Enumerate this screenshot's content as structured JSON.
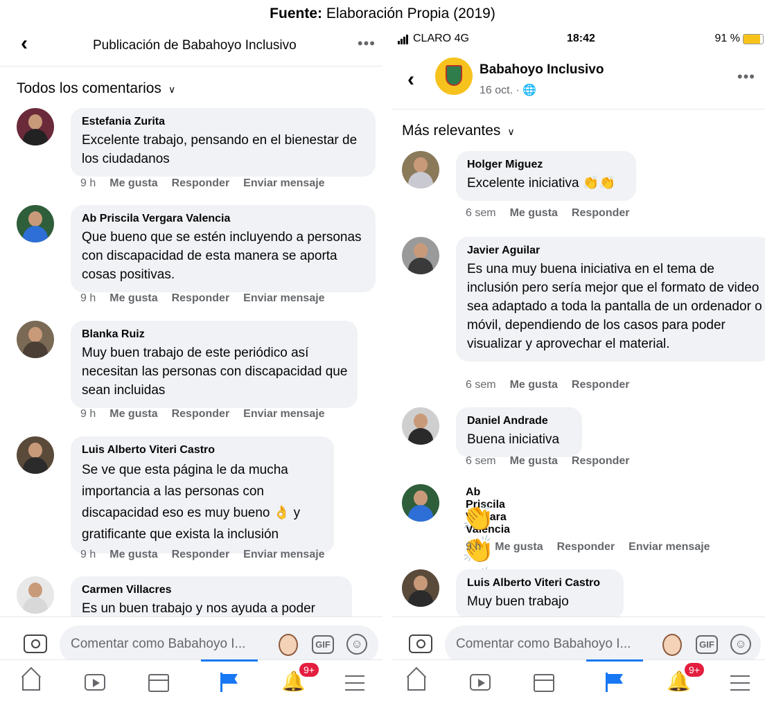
{
  "caption": {
    "bold": "Fuente:",
    "rest": " Elaboración Propia (2019)"
  },
  "left": {
    "header": {
      "title": "Publicación de Babahoyo Inclusivo"
    },
    "sort_label": "Todos los comentarios",
    "comments": [
      {
        "name": "Estefania Zurita",
        "text": "Excelente trabajo, pensando en el bienestar de los ciudadanos",
        "time": "9 h",
        "like": "Me gusta",
        "reply": "Responder",
        "message": "Enviar mensaje"
      },
      {
        "name": "Ab Priscila Vergara Valencia",
        "text": "Que bueno que se estén incluyendo a personas con discapacidad de esta manera se aporta cosas positivas.",
        "time": "9 h",
        "like": "Me gusta",
        "reply": "Responder",
        "message": "Enviar mensaje"
      },
      {
        "name": "Blanka Ruiz",
        "text": "Muy buen trabajo de este periódico así necesitan las personas con discapacidad que sean incluidas",
        "time": "9 h",
        "like": "Me gusta",
        "reply": "Responder",
        "message": "Enviar mensaje"
      },
      {
        "name": "Luis Alberto Viteri Castro",
        "text": "Se ve que esta página le da mucha importancia a las personas con discapacidad eso es muy bueno 👌 y gratificante que exista la inclusión",
        "time": "9 h",
        "like": "Me gusta",
        "reply": "Responder",
        "message": "Enviar mensaje"
      },
      {
        "name": "Carmen Villacres",
        "text": "Es un buen  trabajo y nos ayuda a poder"
      }
    ],
    "composer_placeholder": "Comentar como Babahoyo I..."
  },
  "right": {
    "status": {
      "carrier": "CLARO  4G",
      "time": "18:42",
      "battery": "91 %"
    },
    "page": {
      "name": "Babahoyo Inclusivo",
      "date": "16 oct. · 🌐"
    },
    "sort_label": "Más relevantes",
    "comments": [
      {
        "name": "Holger Miguez",
        "text": "Excelente iniciativa 👏👏",
        "time": "6 sem",
        "like": "Me gusta",
        "reply": "Responder"
      },
      {
        "name": "Javier Aguilar",
        "text": "Es una muy buena iniciativa en el tema de inclusión pero sería mejor que el formato de video sea adaptado a toda la pantalla de un ordenador o móvil, dependiendo de los casos para poder visualizar y aprovechar el material.",
        "time": "6 sem",
        "like": "Me gusta",
        "reply": "Responder"
      },
      {
        "name": "Daniel Andrade",
        "text": "Buena iniciativa",
        "time": "6 sem",
        "like": "Me gusta",
        "reply": "Responder"
      },
      {
        "name": "Ab Priscila Vergara Valencia",
        "text": "👏👏👏",
        "time": "9 h",
        "like": "Me gusta",
        "reply": "Responder",
        "message": "Enviar mensaje"
      },
      {
        "name": "Luis Alberto Viteri Castro",
        "text": "Muy buen trabajo"
      }
    ],
    "composer_placeholder": "Comentar como Babahoyo I..."
  },
  "tabbar": {
    "gif_label": "GIF",
    "notification_count": "9+"
  },
  "icons": [
    "back-arrow-icon",
    "more-icon",
    "chevron-down-icon",
    "camera-icon",
    "gif-icon",
    "emoji-icon",
    "home-icon",
    "video-icon",
    "marketplace-icon",
    "flag-icon",
    "bell-icon",
    "menu-icon",
    "globe-icon"
  ],
  "colors": {
    "accent": "#1877f2",
    "bubble": "#f0f2f5",
    "muted": "#65676b",
    "badge": "#e41e3f",
    "battery": "#f7c31a",
    "logo": "#f6c21d"
  }
}
